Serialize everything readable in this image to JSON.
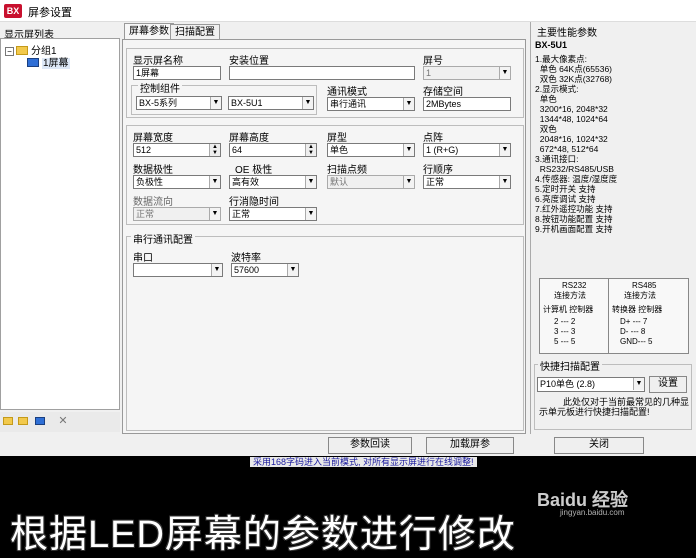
{
  "window": {
    "title": "屏参设置",
    "app_icon": "BX"
  },
  "left": {
    "title": "显示屏列表",
    "tree": {
      "group": "分组1",
      "screen": "1屏幕"
    }
  },
  "tabs": [
    {
      "label": "屏幕参数"
    },
    {
      "label": "扫描配置"
    }
  ],
  "form": {
    "screen_name": {
      "label": "显示屏名称",
      "value": "1屏幕"
    },
    "install_location": {
      "label": "安装位置",
      "value": ""
    },
    "screen_no": {
      "label": "屏号",
      "value": "1"
    },
    "controller_group": {
      "label": "控制组件",
      "series": "BX-5系列",
      "model": "BX-5U1"
    },
    "comm_mode": {
      "label": "通讯模式",
      "value": "串行通讯"
    },
    "storage": {
      "label": "存储空间",
      "value": "2MBytes"
    },
    "width": {
      "label": "屏幕宽度",
      "value": "512"
    },
    "height": {
      "label": "屏幕高度",
      "value": "64"
    },
    "screen_type": {
      "label": "屏型",
      "value": "单色"
    },
    "pixel_order": {
      "label": "点阵",
      "value": "1 (R+G)"
    },
    "data_polarity": {
      "label": "数据极性",
      "value": "负极性"
    },
    "oe_polarity": {
      "label": "OE 极性",
      "value": "高有效"
    },
    "scan_freq": {
      "label": "扫描点频",
      "value": "默认"
    },
    "row_order": {
      "label": "行顺序",
      "value": "正常"
    },
    "data_flow": {
      "label": "数据流向",
      "value": "正常"
    },
    "row_blank": {
      "label": "行消隐时间",
      "value": "正常"
    },
    "serial": {
      "group_title": "串行通讯配置",
      "port_label": "串口",
      "port_value": "",
      "baud_label": "波特率",
      "baud_value": "57600"
    }
  },
  "perf": {
    "title": "主要性能参数",
    "model": "BX-5U1",
    "lines": [
      "1.最大像素点:",
      "  单色 64K点(65536)",
      "  双色 32K点(32768)",
      "2.显示模式:",
      "  单色",
      "  3200*16, 2048*32",
      "  1344*48, 1024*64",
      "  双色",
      "  2048*16, 1024*32",
      "  672*48, 512*64",
      "3.通讯接口:",
      "  RS232/RS485/USB",
      "4.传感器: 温度/湿度度",
      "5.定时开关 支持",
      "6.亮度调试 支持",
      "7.红外遥控功能 支持",
      "8.按钮功能配置 支持",
      "9.开机画面配置 支持"
    ],
    "wiring": {
      "rs232_title": "RS232",
      "rs232_sub": "连接方法",
      "rs232_head": "计算机  控制器",
      "rs232_rows": [
        "2 --- 2",
        "3 --- 3",
        "5 --- 5"
      ],
      "rs485_title": "RS485",
      "rs485_sub": "连接方法",
      "rs485_head": "转换器  控制器",
      "rs485_rows": [
        "D+ --- 7",
        "D- --- 8",
        "GND--- 5"
      ]
    }
  },
  "quick_scan": {
    "title": "快捷扫描配置",
    "value": "P10单色 (2.8)",
    "set_label": "设置",
    "note": "此处仅对于当前最常见的几种显示单元板进行快捷扫描配置!"
  },
  "buttons": {
    "read_params": "参数回读",
    "load_params": "加载屏参",
    "close": "关闭"
  },
  "status_note": "采用168字码进入当前模式, 对所有显示屏进行在线调整!",
  "subtitle": "根据LED屏幕的参数进行修改",
  "watermark": "Baidu 经验",
  "watermark_url": "jingyan.baidu.com"
}
